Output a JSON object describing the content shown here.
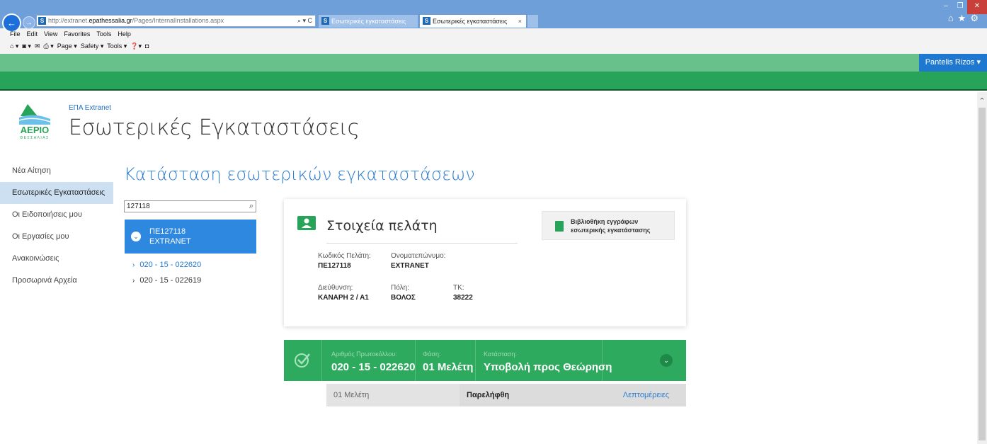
{
  "browser": {
    "address": {
      "prefix": "http://extranet.",
      "domain": "epathessalia.gr",
      "path": "/Pages/InternalInstallations.aspx",
      "tools": "⌕ ▾ C"
    },
    "tabs": [
      {
        "label": "Εσωτερικές εγκαταστάσεις"
      },
      {
        "label": "Εσωτερικές εγκαταστάσεις",
        "close": "×"
      }
    ],
    "favicon": "S",
    "menu": [
      "File",
      "Edit",
      "View",
      "Favorites",
      "Tools",
      "Help"
    ],
    "commands": [
      "Page ▾",
      "Safety ▾",
      "Tools ▾"
    ],
    "top_icons": "⌂★⚙"
  },
  "suite": {
    "user": "Pantelis Rizos ▾"
  },
  "site": {
    "crumb": "ΕΠΑ Extranet",
    "title": "Εσωτερικές Εγκαταστάσεις",
    "logo_text": "ΑΕΡΙΟ",
    "logo_sub": "ΘΕΣΣΑΛΙΑΣ"
  },
  "nav": [
    {
      "label": "Νέα Αίτηση"
    },
    {
      "label": "Εσωτερικές Εγκαταστάσεις",
      "selected": true
    },
    {
      "label": "Οι Ειδοποιήσεις μου"
    },
    {
      "label": "Οι Εργασίες μου"
    },
    {
      "label": "Ανακοινώσεις"
    },
    {
      "label": "Προσωρινά Αρχεία"
    }
  ],
  "main": {
    "title": "Κατάσταση εσωτερικών εγκαταστάσεων",
    "search_value": "127118",
    "customer": {
      "code": "ΠΕ127118",
      "name": "EXTRANET"
    },
    "requests": [
      "020 - 15 - 022620",
      "020 - 15 - 022619"
    ]
  },
  "customer_info": {
    "title": "Στοιχεία πελάτη",
    "library_button": {
      "line1": "Βιβλιοθήκη εγγράφων",
      "line2": "εσωτερικής εγκατάστασης"
    },
    "fields": {
      "code_label": "Κωδικός Πελάτη:",
      "code": "ΠΕ127118",
      "name_label": "Ονοματεπώνυμο:",
      "name": "EXTRANET",
      "address_label": "Διεύθυνση:",
      "address": "ΚΑΝΑΡΗ 2 / Α1",
      "city_label": "Πόλη:",
      "city": "ΒΟΛΟΣ",
      "zip_label": "ΤΚ:",
      "zip": "38222"
    }
  },
  "status": {
    "protocol_label": "Αριθμός Πρωτοκόλλου:",
    "protocol": "020 - 15 - 022620",
    "phase_label": "Φάση:",
    "phase": "01 Μελέτη",
    "state_label": "Κατάσταση:",
    "state": "Υποβολή προς Θεώρηση",
    "expand": "⌄"
  },
  "detail": {
    "phase": "01 Μελέτη",
    "status": "Παρελήφθη",
    "link": "Λεπτομέρειες"
  },
  "colors": {
    "green": "#2eaa5e",
    "blue": "#2f88df",
    "link": "#2a7dd2"
  }
}
